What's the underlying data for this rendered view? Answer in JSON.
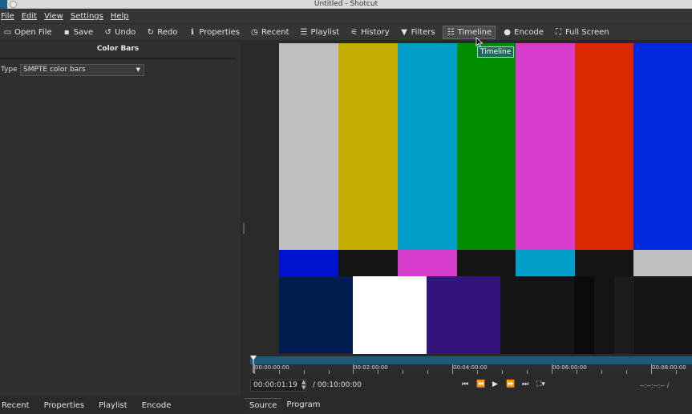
{
  "window": {
    "title": "Untitled - Shotcut"
  },
  "menu": [
    "File",
    "Edit",
    "View",
    "Settings",
    "Help"
  ],
  "toolbar": {
    "open_file": "Open File",
    "save": "Save",
    "undo": "Undo",
    "redo": "Redo",
    "properties": "Properties",
    "recent": "Recent",
    "playlist": "Playlist",
    "history": "History",
    "filters": "Filters",
    "timeline": "Timeline",
    "encode": "Encode",
    "full_screen": "Full Screen"
  },
  "tooltip": "Timeline",
  "panel": {
    "title": "Color Bars",
    "type_label": "Type",
    "type_value": "SMPTE color bars"
  },
  "left_tabs": [
    "Recent",
    "Properties",
    "Playlist",
    "Encode"
  ],
  "ruler": {
    "labels": [
      "00:00:00:00",
      "00:02:00:00",
      "00:04:00:00",
      "00:06:00:00",
      "00:08:00:00"
    ]
  },
  "transport": {
    "timecode": "00:00:01:19",
    "duration": "/ 00:10:00:00",
    "in_out": "--:--:--:-- /"
  },
  "video_tabs": [
    "Source",
    "Program"
  ],
  "colors": {
    "bar_top": [
      "#c0c0c0",
      "#c4ac00",
      "#00a0c8",
      "#008c00",
      "#d83ccd",
      "#dc2800",
      "#0028dc"
    ],
    "bar_mid": [
      "#0014d0",
      "#141414",
      "#d83ccd",
      "#141414",
      "#00a0c8",
      "#141414",
      "#c0c0c0"
    ],
    "bar_bottom": [
      "#001e50",
      "#ffffff",
      "#32147a",
      "#141414",
      "#0a0a0a",
      "#141414",
      "#1c1c1c",
      "#141414"
    ]
  }
}
